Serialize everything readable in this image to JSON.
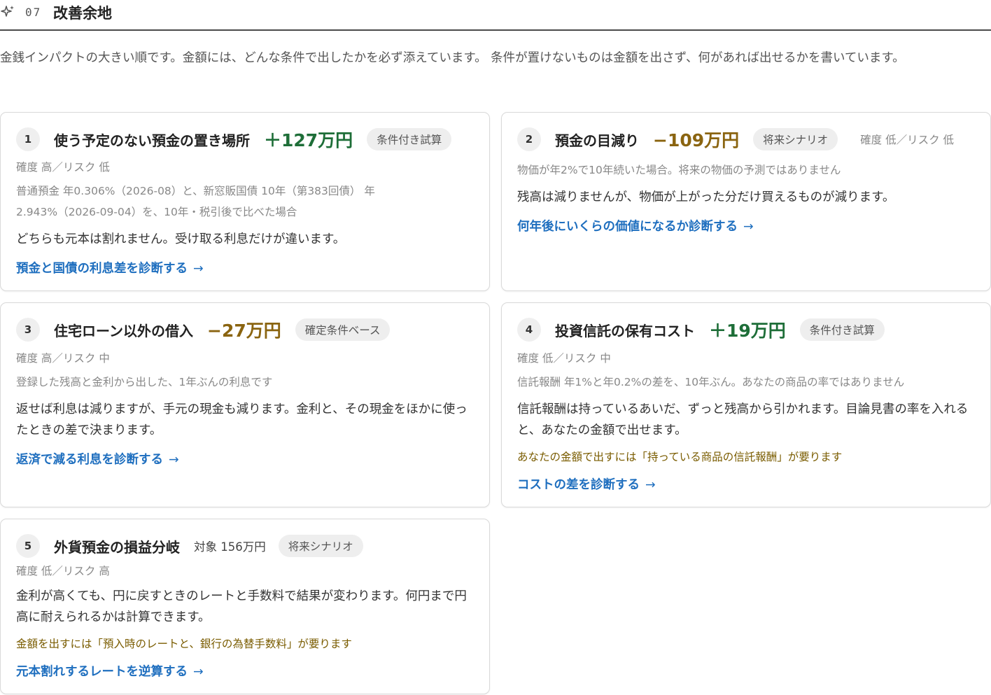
{
  "section": {
    "number": "07",
    "title": "改善余地",
    "intro": "金銭インパクトの大きい順です。金額には、どんな条件で出したかを必ず添えています。 条件が置けないものは金額を出さず、何があれば出せるかを書いています。"
  },
  "colors": {
    "positive_amount": "#1e6e38",
    "negative_amount": "#8a6410",
    "link": "#1f6fbf",
    "requirement_text": "#7a5c00"
  },
  "cards": [
    {
      "num": "1",
      "title": "使う予定のない預金の置き場所",
      "amount": "＋127万円",
      "amount_sign": "positive",
      "tag": "条件付き試算",
      "meta": "確度 高／リスク 低",
      "condition": "普通預金 年0.306%（2026-08）と、新窓販国債 10年（第383回債） 年2.943%（2026-09-04）を、10年・税引後で比べた場合",
      "description": "どちらも元本は割れません。受け取る利息だけが違います。",
      "link": "預金と国債の利息差を診断する",
      "link_icon": "arrow-right-icon"
    },
    {
      "num": "2",
      "title": "預金の目減り",
      "amount": "−109万円",
      "amount_sign": "negative",
      "tag": "将来シナリオ",
      "meta": "確度 低／リスク 低",
      "condition": "物価が年2%で10年続いた場合。将来の物価の予測ではありません",
      "description": "残高は減りませんが、物価が上がった分だけ買えるものが減ります。",
      "link": "何年後にいくらの価値になるか診断する",
      "link_icon": "arrow-right-icon"
    },
    {
      "num": "3",
      "title": "住宅ローン以外の借入",
      "amount": "−27万円",
      "amount_sign": "negative",
      "tag": "確定条件ベース",
      "meta": "確度 高／リスク 中",
      "condition": "登録した残高と金利から出した、1年ぶんの利息です",
      "description": "返せば利息は減りますが、手元の現金も減ります。金利と、その現金をほかに使ったときの差で決まります。",
      "link": "返済で減る利息を診断する",
      "link_icon": "arrow-right-icon"
    },
    {
      "num": "4",
      "title": "投資信託の保有コスト",
      "amount": "＋19万円",
      "amount_sign": "positive",
      "tag": "条件付き試算",
      "meta": "確度 低／リスク 中",
      "condition": "信託報酬 年1%と年0.2%の差を、10年ぶん。あなたの商品の率ではありません",
      "description": "信託報酬は持っているあいだ、ずっと残高から引かれます。目論見書の率を入れると、あなたの金額で出せます。",
      "requirement": "あなたの金額で出すには「持っている商品の信託報酬」が要ります",
      "link": "コストの差を診断する",
      "link_icon": "arrow-right-icon"
    },
    {
      "num": "5",
      "title": "外貨預金の損益分岐",
      "target": "対象 156万円",
      "tag": "将来シナリオ",
      "meta": "確度 低／リスク 高",
      "description": "金利が高くても、円に戻すときのレートと手数料で結果が変わります。何円まで円高に耐えられるかは計算できます。",
      "requirement": "金額を出すには「預入時のレートと、銀行の為替手数料」が要ります",
      "link": "元本割れするレートを逆算する",
      "link_icon": "arrow-right-icon"
    }
  ]
}
